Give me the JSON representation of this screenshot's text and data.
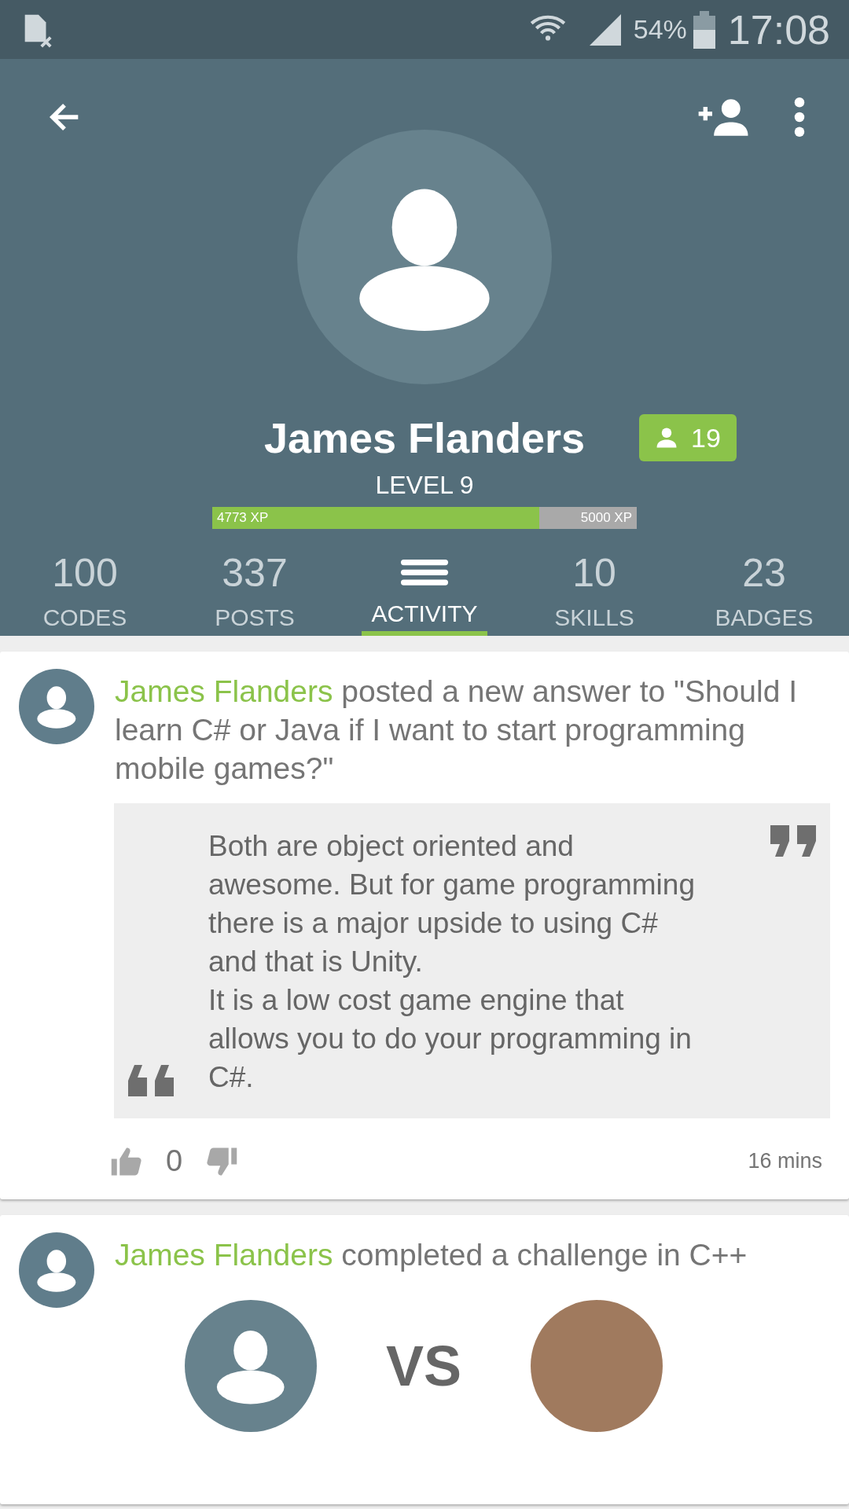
{
  "status_bar": {
    "battery": "54%",
    "time": "17:08"
  },
  "profile": {
    "name": "James Flanders",
    "followers": "19",
    "level_label": "LEVEL 9",
    "xp": {
      "current": "4773 XP",
      "target": "5000 XP",
      "level": 0.77
    }
  },
  "tabs": [
    {
      "kind": "count",
      "value": "100",
      "label": "CODES",
      "selected": false
    },
    {
      "kind": "count",
      "value": "337",
      "label": "POSTS",
      "selected": false
    },
    {
      "kind": "icon",
      "label": "ACTIVITY",
      "selected": true
    },
    {
      "kind": "count",
      "value": "10",
      "label": "SKILLS",
      "selected": false
    },
    {
      "kind": "count",
      "value": "23",
      "label": "BADGES",
      "selected": false
    }
  ],
  "feed": [
    {
      "kind": "answer",
      "author": "James Flanders",
      "text": "posted a new answer to \"Should I learn C# or Java if I want to start programming mobile games?\"",
      "quote": "Both are object oriented and awesome. But for game programming there is a major upside to using C# and that is Unity.\nIt is a low cost game engine that allows you to do your programming in C#.",
      "votes": "0",
      "time": "16 mins"
    },
    {
      "kind": "challenge",
      "author": "James Flanders",
      "text": "completed a challenge in C++",
      "versus": "VS"
    }
  ]
}
